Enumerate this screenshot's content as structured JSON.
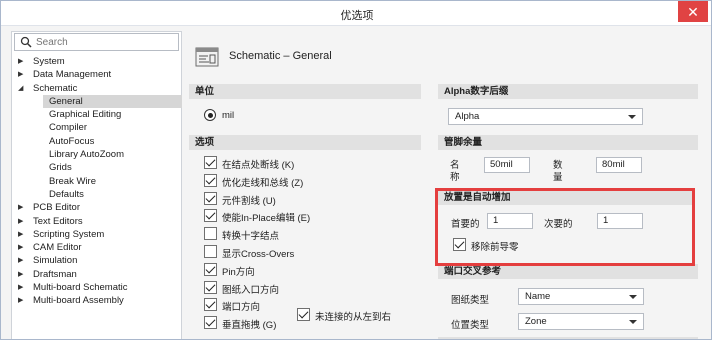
{
  "window": {
    "title": "优选项",
    "close_glyph": "✕"
  },
  "search": {
    "placeholder": "Search",
    "value": ""
  },
  "tree": [
    {
      "label": "System",
      "arrow": "▶",
      "child": false,
      "selected": false
    },
    {
      "label": "Data Management",
      "arrow": "▶",
      "child": false,
      "selected": false
    },
    {
      "label": "Schematic",
      "arrow": "◢",
      "child": false,
      "selected": false
    },
    {
      "label": "General",
      "arrow": "",
      "child": true,
      "selected": true
    },
    {
      "label": "Graphical Editing",
      "arrow": "",
      "child": true,
      "selected": false
    },
    {
      "label": "Compiler",
      "arrow": "",
      "child": true,
      "selected": false
    },
    {
      "label": "AutoFocus",
      "arrow": "",
      "child": true,
      "selected": false
    },
    {
      "label": "Library AutoZoom",
      "arrow": "",
      "child": true,
      "selected": false
    },
    {
      "label": "Grids",
      "arrow": "",
      "child": true,
      "selected": false
    },
    {
      "label": "Break Wire",
      "arrow": "",
      "child": true,
      "selected": false
    },
    {
      "label": "Defaults",
      "arrow": "",
      "child": true,
      "selected": false
    },
    {
      "label": "PCB Editor",
      "arrow": "▶",
      "child": false,
      "selected": false
    },
    {
      "label": "Text Editors",
      "arrow": "▶",
      "child": false,
      "selected": false
    },
    {
      "label": "Scripting System",
      "arrow": "▶",
      "child": false,
      "selected": false
    },
    {
      "label": "CAM Editor",
      "arrow": "▶",
      "child": false,
      "selected": false
    },
    {
      "label": "Simulation",
      "arrow": "▶",
      "child": false,
      "selected": false
    },
    {
      "label": "Draftsman",
      "arrow": "▶",
      "child": false,
      "selected": false
    },
    {
      "label": "Multi-board Schematic",
      "arrow": "▶",
      "child": false,
      "selected": false
    },
    {
      "label": "Multi-board Assembly",
      "arrow": "▶",
      "child": false,
      "selected": false
    }
  ],
  "page": {
    "title": "Schematic – General"
  },
  "units": {
    "section": "单位",
    "radio_label": "mil"
  },
  "options": {
    "section": "选项",
    "items": [
      {
        "label": "在结点处断线 (K)",
        "checked": true
      },
      {
        "label": "优化走线和总线 (Z)",
        "checked": true
      },
      {
        "label": "元件割线 (U)",
        "checked": true
      },
      {
        "label": "使能In-Place编辑 (E)",
        "checked": true
      },
      {
        "label": "转换十字结点",
        "checked": false
      },
      {
        "label": "显示Cross-Overs",
        "checked": false
      },
      {
        "label": "Pin方向",
        "checked": true
      },
      {
        "label": "图纸入口方向",
        "checked": true
      },
      {
        "label": "端口方向",
        "checked": true
      },
      {
        "label": "垂直拖拽 (G)",
        "checked": true
      }
    ],
    "extra": {
      "label": "未连接的从左到右",
      "checked": true
    }
  },
  "alpha": {
    "section": "Alpha数字后缀",
    "value": "Alpha"
  },
  "pin_margin": {
    "section": "管脚余量",
    "name_label": "名称",
    "name_value": "50mil",
    "number_label": "数量",
    "number_value": "80mil"
  },
  "auto_increment": {
    "section": "放置是自动增加",
    "primary_label": "首要的",
    "primary_value": "1",
    "secondary_label": "次要的",
    "secondary_value": "1",
    "remove_zeros_label": "移除前导零",
    "remove_zeros_checked": true
  },
  "port_ref": {
    "section": "端口交叉参考",
    "sheet_type_label": "图纸类型",
    "sheet_type_value": "Name",
    "location_type_label": "位置类型",
    "location_type_value": "Zone"
  },
  "colors": {
    "highlight_box": "#e43e3e",
    "close_button": "#e04343"
  }
}
